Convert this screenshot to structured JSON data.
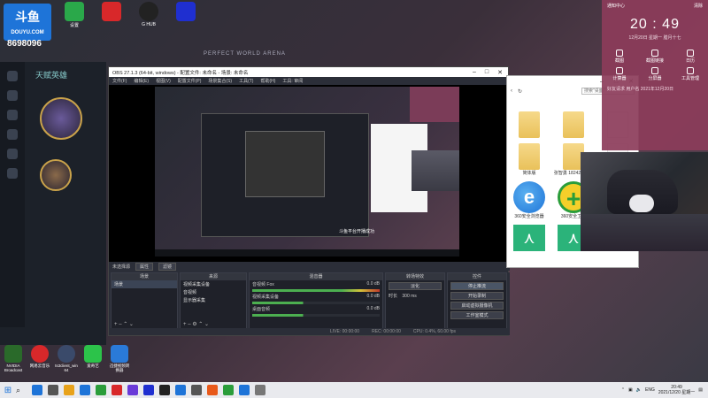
{
  "desktop": {
    "douyu_logo": "斗鱼",
    "douyu_sub": "DOUYU.COM",
    "douyu_number": "8698096",
    "top_icons": [
      {
        "label": "设置",
        "color": "#2aa84a"
      },
      {
        "label": "",
        "color": "#d8282a"
      },
      {
        "label": "G HUB",
        "color": "#222222"
      },
      {
        "label": "",
        "color": "#1f2fd0"
      }
    ],
    "game_window_title": "PERFECT WORLD ARENA",
    "game_header": "天赋英雄"
  },
  "obs": {
    "title": "OBS 27.1.3 (64-bit, windows) - 配置文件: 未命名 - 场景: 未命名",
    "menu": [
      "文件(F)",
      "编辑(E)",
      "视图(V)",
      "配置文件(P)",
      "场景集合(S)",
      "工具(T)",
      "帮助(H)",
      "工具: 审阅"
    ],
    "preview_caption": "斗鱼平台开播成功",
    "source_bar_label": "未选择源",
    "source_bar_buttons": [
      "属性",
      "滤镜"
    ],
    "docks": {
      "scenes": {
        "title": "场景",
        "items": [
          "场景"
        ]
      },
      "sources": {
        "title": "来源",
        "items": [
          "视频采集设备",
          "音视频",
          "显示器采集"
        ]
      },
      "mixer": {
        "title": "混音器",
        "rows": [
          {
            "label": "音视频 Fox",
            "db": "0.0 dB"
          },
          {
            "label": "视频采集设备",
            "db": "0.0 dB"
          },
          {
            "label": "桌面音频",
            "db": "0.0 dB"
          }
        ]
      },
      "transitions": {
        "title": "转场特效",
        "type": "淡化",
        "duration_label": "时长",
        "duration": "300 ms"
      },
      "controls": {
        "title": "控件",
        "buttons": [
          "停止推流",
          "开始录制",
          "启动虚拟摄像机",
          "工作室模式",
          "设置",
          "退出"
        ]
      }
    },
    "status": {
      "live": "LIVE: 00:00:00",
      "rec": "REC: 00:00:00",
      "cpu": "CPU: 0.4%, 60.00 fps"
    }
  },
  "explorer": {
    "search_placeholder": "搜索\"桌面\"",
    "items": [
      {
        "label": "",
        "kind": "folder"
      },
      {
        "label": "",
        "kind": "folder"
      },
      {
        "label": "",
        "kind": "doc"
      },
      {
        "label": "简体版",
        "kind": "folder"
      },
      {
        "label": "张智勇 1824220326",
        "kind": "folder"
      },
      {
        "label": "",
        "kind": "doc"
      },
      {
        "label": "360安全浏览器",
        "kind": "ie"
      },
      {
        "label": "360安全卫士",
        "kind": "plus"
      },
      {
        "label": "",
        "kind": "none"
      },
      {
        "label": "",
        "kind": "pdf"
      },
      {
        "label": "",
        "kind": "pdf"
      },
      {
        "label": "",
        "kind": "p"
      }
    ]
  },
  "clock_panel": {
    "header_left": "通知中心",
    "header_right": "清除",
    "time": "20 : 49",
    "date": "12月20日  星期一  腊月十七",
    "cells": [
      "截图",
      "截图链接",
      "日历",
      "计算器",
      "分屏器",
      "工具管理"
    ],
    "news": "好友请求 用户名 2021年12月20日"
  },
  "bottom_apps": [
    {
      "label": "NVIDIA Broadcast",
      "color": "#2a6a2a"
    },
    {
      "label": "网易云音乐",
      "color": "#d8282a"
    },
    {
      "label": "ts3client_win 64",
      "color": "#3a4a6a"
    },
    {
      "label": "爱奇艺",
      "color": "#2cc34a"
    },
    {
      "label": "迅捷视频转换器",
      "color": "#2a7ad8"
    }
  ],
  "taskbar": {
    "icons": [
      "#1e74d8",
      "#555555",
      "#e8a21a",
      "#1e74d8",
      "#2a9d3a",
      "#d8282a",
      "#6a3ad8",
      "#1f2fd0",
      "#222222",
      "#1e74d8",
      "#555555",
      "#e8591a",
      "#2a9d3a",
      "#1e74d8",
      "#777777"
    ],
    "tray_lang": "ENG",
    "time": "20:49",
    "date": "2021/12/20 星期一"
  }
}
